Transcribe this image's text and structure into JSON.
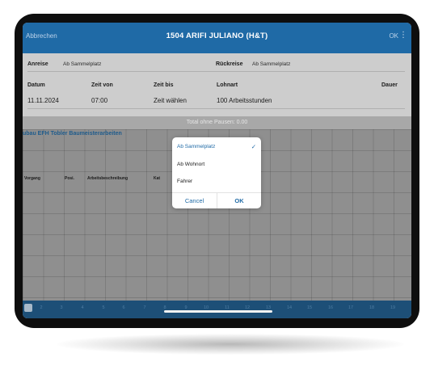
{
  "header": {
    "cancel_label": "Abbrechen",
    "title": "1504 ARIFI JULIANO (H&T)",
    "ok_label": "OK",
    "more_icon": "more-vertical-icon"
  },
  "form": {
    "anreise_label": "Anreise",
    "anreise_value": "Ab Sammelplatz",
    "rueckreise_label": "Rückreise",
    "rueckreise_value": "Ab Sammelplatz",
    "columns": {
      "datum": "Datum",
      "zeit_von": "Zeit von",
      "zeit_bis": "Zeit bis",
      "lohnart": "Lohnart",
      "dauer": "Dauer"
    },
    "row": {
      "datum": "11.11.2024",
      "zeit_von": "07:00",
      "zeit_bis": "Zeit wählen",
      "lohnart": "100 Arbeitsstunden"
    }
  },
  "total": "Total ohne Pausen: 0.00",
  "project": "ubau EFH Tobler Baumeisterarbeiten",
  "table_headers": [
    "Vorgang",
    "Posi.",
    "Arbeitsbeschreibung",
    "Kat"
  ],
  "footer": {
    "numbers": [
      "2",
      "3",
      "4",
      "5",
      "6",
      "7",
      "8",
      "9",
      "10",
      "11",
      "12",
      "13",
      "14",
      "15",
      "16",
      "17",
      "18",
      "19"
    ]
  },
  "dialog": {
    "options": [
      {
        "label": "Ab Sammelplatz",
        "selected": true
      },
      {
        "label": "Ab Wohnort",
        "selected": false
      },
      {
        "label": "Fahrer",
        "selected": false
      }
    ],
    "check_glyph": "✓",
    "cancel_label": "Cancel",
    "ok_label": "OK"
  },
  "colors": {
    "accent": "#1f6aa6",
    "footer": "#1d4f77",
    "project_text": "#1e5b8c"
  }
}
